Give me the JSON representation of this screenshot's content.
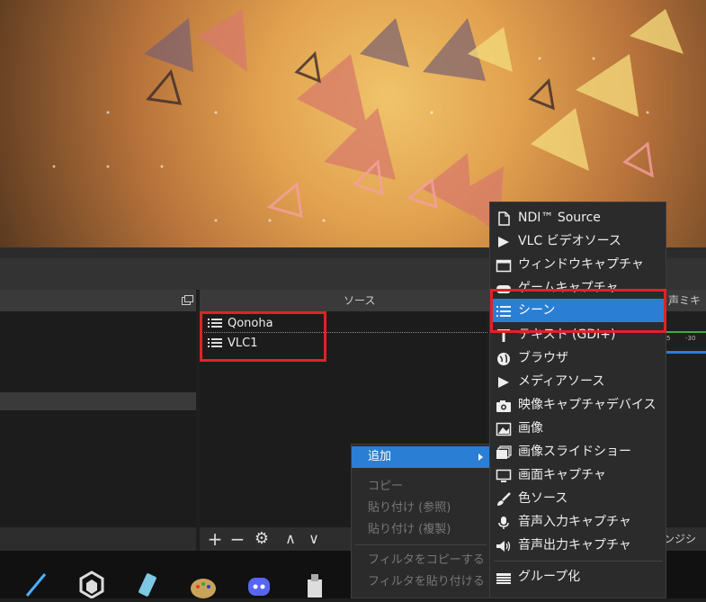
{
  "colors": {
    "highlight": "#2a7fd4",
    "red_box": "#e0222a",
    "dock_bg": "#1c1c1c",
    "title_bar": "#3a3a3a"
  },
  "sources_panel": {
    "title": "ソース",
    "items": [
      {
        "label": "Qonoha",
        "icon": "scene-list-icon"
      },
      {
        "label": "VLC1",
        "icon": "scene-list-icon"
      }
    ],
    "controls": [
      {
        "icon": "plus-icon",
        "glyph": "+"
      },
      {
        "icon": "minus-icon",
        "glyph": "−"
      },
      {
        "icon": "gear-icon",
        "glyph": "⚙"
      },
      {
        "icon": "chevron-up-icon",
        "glyph": "∧"
      },
      {
        "icon": "chevron-down-icon",
        "glyph": "∨"
      }
    ]
  },
  "mixer_panel": {
    "title_fragment": "声ミキサ",
    "meter_ticks": [
      "5",
      "-30"
    ]
  },
  "transition_panel": {
    "title_fragment": "ンジショ"
  },
  "context_menu": {
    "items": [
      {
        "label": "追加",
        "enabled": true,
        "active": true,
        "has_submenu": true
      },
      {
        "label": "コピー",
        "enabled": false
      },
      {
        "label": "貼り付け (参照)",
        "enabled": false
      },
      {
        "label": "貼り付け (複製)",
        "enabled": false
      },
      {
        "label": "フィルタをコピーする",
        "enabled": false
      },
      {
        "label": "フィルタを貼り付ける",
        "enabled": false
      }
    ]
  },
  "add_submenu": {
    "items": [
      {
        "label": "NDI™ Source",
        "icon": "file-icon"
      },
      {
        "label": "VLC ビデオソース",
        "icon": "play-icon"
      },
      {
        "label": "ウィンドウキャプチャ",
        "icon": "window-icon"
      },
      {
        "label": "ゲームキャプチャ",
        "icon": "gamepad-icon"
      },
      {
        "label": "シーン",
        "icon": "scene-list-icon",
        "active": true
      },
      {
        "label": "テキスト (GDI+)",
        "icon": "text-icon"
      },
      {
        "label": "ブラウザ",
        "icon": "globe-icon"
      },
      {
        "label": "メディアソース",
        "icon": "play-icon"
      },
      {
        "label": "映像キャプチャデバイス",
        "icon": "camera-icon"
      },
      {
        "label": "画像",
        "icon": "image-icon"
      },
      {
        "label": "画像スライドショー",
        "icon": "slideshow-icon"
      },
      {
        "label": "画面キャプチャ",
        "icon": "monitor-icon"
      },
      {
        "label": "色ソース",
        "icon": "brush-icon"
      },
      {
        "label": "音声入力キャプチャ",
        "icon": "microphone-icon"
      },
      {
        "label": "音声出力キャプチャ",
        "icon": "speaker-icon"
      },
      {
        "label": "グループ化",
        "icon": "folder-icon"
      }
    ]
  },
  "taskbar": {
    "icons": [
      "app-icon-line",
      "app-icon-hexagon",
      "app-icon-pen",
      "app-icon-palette",
      "discord-icon",
      "app-icon-box"
    ]
  }
}
